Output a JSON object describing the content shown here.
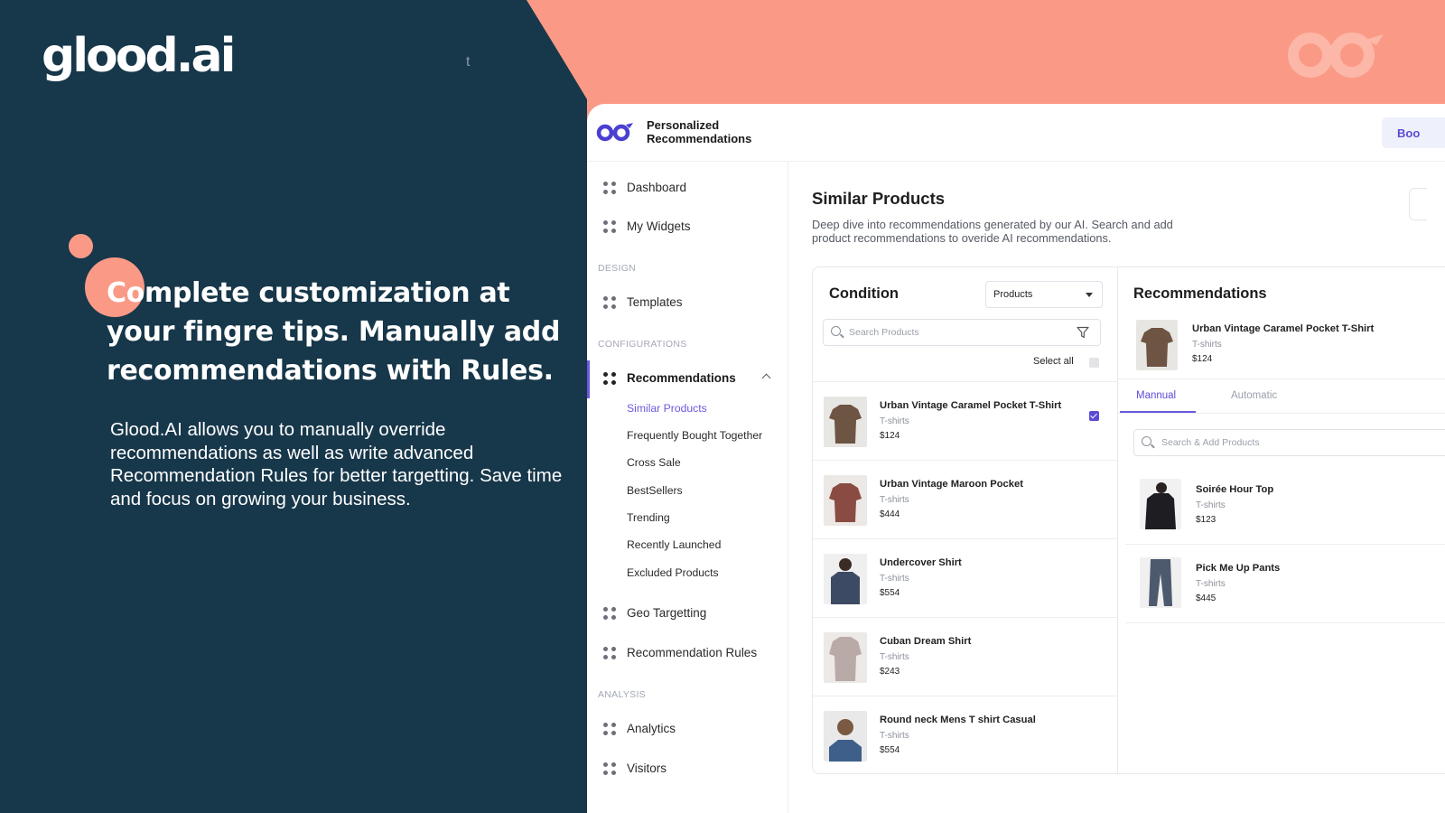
{
  "marketing": {
    "brand": "glood.ai",
    "stray_char": "t",
    "headline": "Complete customization at your fingre tips. Manually add recommendations with Rules.",
    "subcopy": "Glood.AI allows you to manually override recommendations as well as write advanced Recommendation Rules for better targetting. Save time and focus on growing your business."
  },
  "colors": {
    "navy": "#17374a",
    "salmon": "#fa9a86",
    "accent": "#5a4bd6"
  },
  "app": {
    "title": "Personalized Recommendations",
    "header_button": "Boo"
  },
  "sidebar": {
    "dashboard": "Dashboard",
    "my_widgets": "My Widgets",
    "section_design": "DESIGN",
    "templates": "Templates",
    "section_config": "CONFIGURATIONS",
    "recommendations": "Recommendations",
    "sub_items": [
      "Similar Products",
      "Frequently Bought Together",
      "Cross Sale",
      "BestSellers",
      "Trending",
      "Recently Launched",
      "Excluded Products"
    ],
    "geo_targetting": "Geo Targetting",
    "recommendation_rules": "Recommendation Rules",
    "section_analysis": "ANALYSIS",
    "analytics": "Analytics",
    "visitors": "Visitors"
  },
  "page": {
    "title": "Similar Products",
    "description": "Deep dive into recommendations generated by our AI. Search and add product recommendations to overide AI recommendations."
  },
  "condition": {
    "title": "Condition",
    "select_value": "Products",
    "search_placeholder": "Search Products",
    "select_all": "Select all",
    "products": [
      {
        "name": "Urban Vintage Caramel Pocket T-Shirt",
        "category": "T-shirts",
        "price": "$124",
        "checked": true
      },
      {
        "name": "Urban Vintage Maroon Pocket",
        "category": "T-shirts",
        "price": "$444",
        "checked": false
      },
      {
        "name": "Undercover Shirt",
        "category": "T-shirts",
        "price": "$554",
        "checked": false
      },
      {
        "name": "Cuban Dream Shirt",
        "category": "T-shirts",
        "price": "$243",
        "checked": false
      },
      {
        "name": "Round neck Mens T shirt Casual",
        "category": "T-shirts",
        "price": "$554",
        "checked": false
      }
    ]
  },
  "recommendations": {
    "title": "Recommendations",
    "selected": {
      "name": "Urban Vintage Caramel Pocket T-Shirt",
      "category": "T-shirts",
      "price": "$124"
    },
    "tab_manual": "Mannual",
    "tab_automatic": "Automatic",
    "search_placeholder": "Search & Add Products",
    "items": [
      {
        "name": "Soirée Hour Top",
        "category": "T-shirts",
        "price": "$123"
      },
      {
        "name": "Pick Me Up Pants",
        "category": "T-shirts",
        "price": "$445"
      }
    ]
  }
}
